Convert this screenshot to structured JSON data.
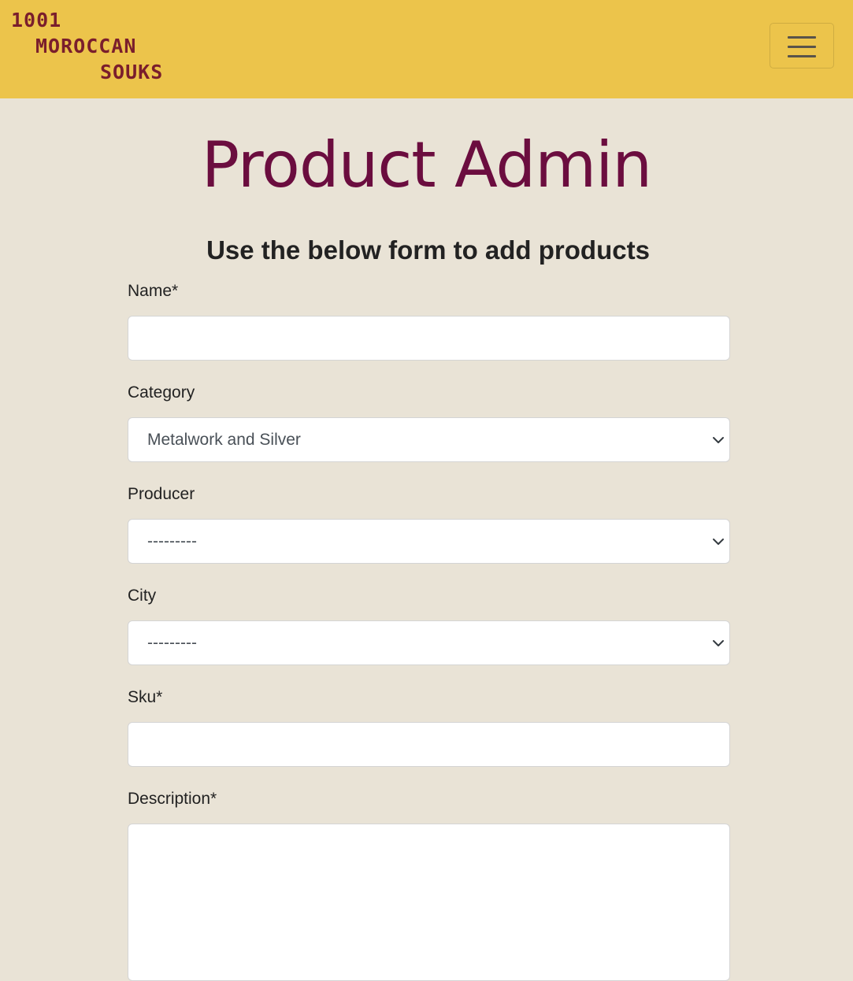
{
  "navbar": {
    "logo": {
      "line1": "1001",
      "line2": "MOROCCAN",
      "line3": "SOUKS"
    },
    "toggler_icon": "hamburger-menu-icon"
  },
  "main": {
    "title": "Product Admin",
    "subtitle": "Use the below form to add products"
  },
  "form": {
    "name": {
      "label": "Name*",
      "value": ""
    },
    "category": {
      "label": "Category",
      "selected": "Metalwork and Silver"
    },
    "producer": {
      "label": "Producer",
      "selected": "---------"
    },
    "city": {
      "label": "City",
      "selected": "---------"
    },
    "sku": {
      "label": "Sku*",
      "value": ""
    },
    "description": {
      "label": "Description*",
      "value": ""
    }
  },
  "colors": {
    "navbar": "#ecc44b",
    "background": "#e9e3d6",
    "title": "#6b0d3f",
    "logo": "#7a1e2c"
  }
}
